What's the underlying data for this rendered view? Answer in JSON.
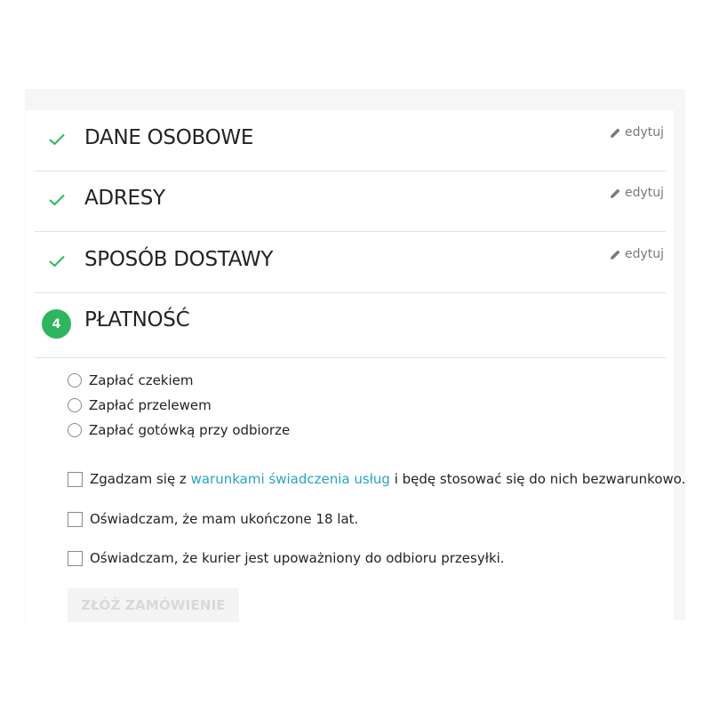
{
  "colors": {
    "accent_green": "#2fb55d",
    "link_blue": "#2aa3c6",
    "border": "#e2e2e2"
  },
  "steps": [
    {
      "title": "DANE OSOBOWE",
      "status": "completed",
      "edit_label": "edytuj",
      "icon": "check-icon"
    },
    {
      "title": "ADRESY",
      "status": "completed",
      "edit_label": "edytuj",
      "icon": "check-icon"
    },
    {
      "title": "SPOSÓB DOSTAWY",
      "status": "completed",
      "edit_label": "edytuj",
      "icon": "check-icon"
    },
    {
      "title": "PŁATNOŚĆ",
      "status": "current",
      "number": "4"
    }
  ],
  "payment_options": [
    {
      "label": "Zapłać czekiem",
      "selected": false
    },
    {
      "label": "Zapłać przelewem",
      "selected": false
    },
    {
      "label": "Zapłać gotówką przy odbiorze",
      "selected": false
    }
  ],
  "terms": {
    "prefix": "Zgadzam się z ",
    "link": "warunkami świadczenia usług",
    "suffix": " i będę stosować się do nich bezwarunkowo."
  },
  "declarations": [
    "Oświadczam, że mam ukończone 18 lat.",
    "Oświadczam, że kurier jest upoważniony do odbioru przesyłki."
  ],
  "submit_label": "ZŁÓŻ ZAMÓWIENIE"
}
